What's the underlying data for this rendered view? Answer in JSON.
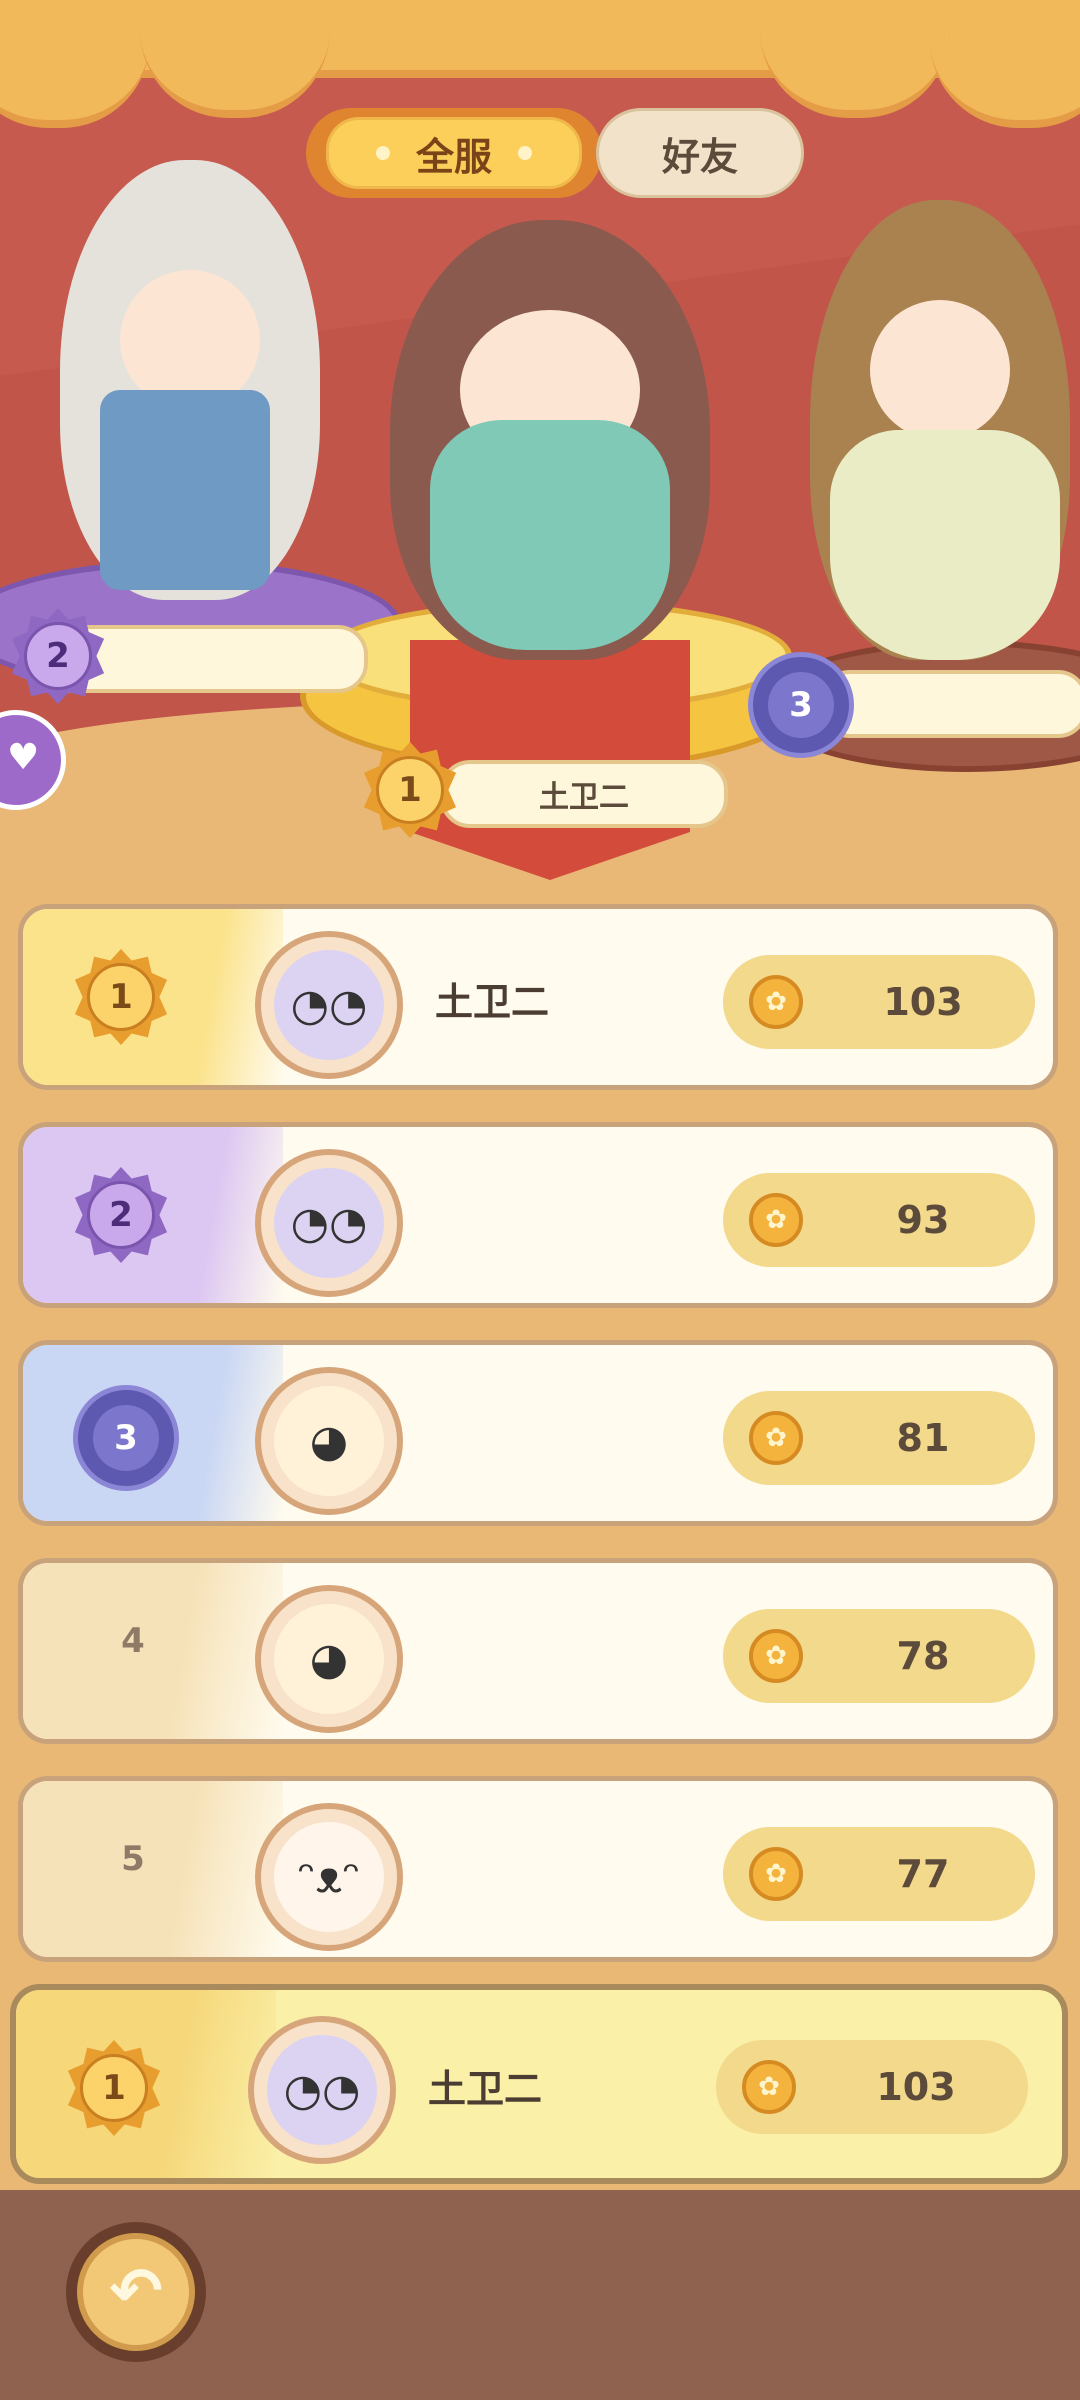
{
  "tabs": {
    "all_servers": "全服",
    "friends": "好友"
  },
  "podium": {
    "first": {
      "rank": "1",
      "name": "土卫二"
    },
    "second": {
      "rank": "2"
    },
    "third": {
      "rank": "3"
    }
  },
  "leaderboard": [
    {
      "rank": "1",
      "name": "土卫二",
      "score": "103",
      "avatar": "ghost-glasses-icon"
    },
    {
      "rank": "2",
      "name": "",
      "score": "93",
      "avatar": "ghost-glasses-icon"
    },
    {
      "rank": "3",
      "name": "",
      "score": "81",
      "avatar": "goose-icon"
    },
    {
      "rank": "4",
      "name": "",
      "score": "78",
      "avatar": "goose-icon"
    },
    {
      "rank": "5",
      "name": "",
      "score": "77",
      "avatar": "bunny-icon"
    }
  ],
  "self_row": {
    "rank": "1",
    "name": "土卫二",
    "score": "103",
    "avatar": "ghost-glasses-icon"
  },
  "icons": {
    "score": "shell-coin-icon",
    "back": "back-arrow-icon",
    "side": "bunny-icon"
  },
  "colors": {
    "accent_gold": "#f5c542",
    "accent_purple": "#9b74c9",
    "accent_blue": "#5d58b0",
    "panel_bg": "#fffbee",
    "bottom_bar": "#8e624e"
  }
}
